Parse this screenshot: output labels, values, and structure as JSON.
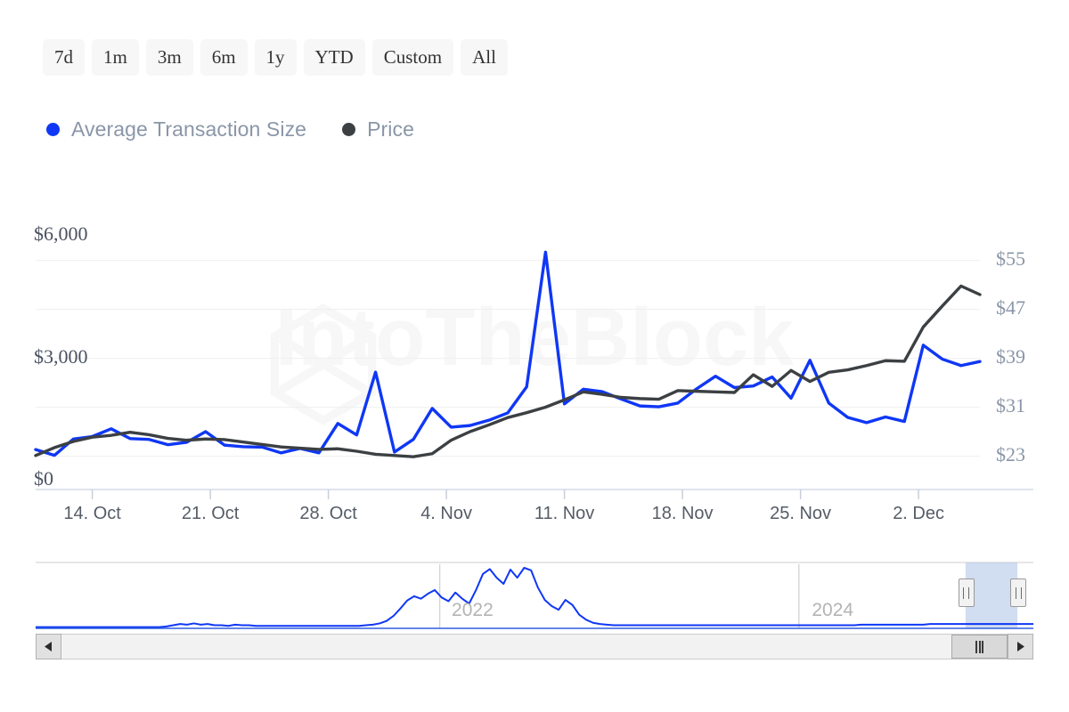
{
  "range_selector": {
    "buttons": [
      {
        "label": "7d",
        "selected": false
      },
      {
        "label": "1m",
        "selected": false
      },
      {
        "label": "3m",
        "selected": false
      },
      {
        "label": "6m",
        "selected": false
      },
      {
        "label": "1y",
        "selected": false
      },
      {
        "label": "YTD",
        "selected": false
      },
      {
        "label": "Custom",
        "selected": false
      },
      {
        "label": "All",
        "selected": false
      }
    ]
  },
  "legend": {
    "items": [
      {
        "label": "Average Transaction Size",
        "color": "#0f37f5",
        "icon": "circle-marker-icon"
      },
      {
        "label": "Price",
        "color": "#3c4043",
        "icon": "circle-marker-icon"
      }
    ]
  },
  "watermark": {
    "text": "IntoTheBlock",
    "logo": "hexagon-logo-icon"
  },
  "navigator": {
    "year_labels": [
      "2022",
      "2024"
    ],
    "left_handle": "navigator-left-handle",
    "right_handle": "navigator-right-handle"
  },
  "scrollbar": {
    "left_arrow": "scroll-left-arrow-icon",
    "right_arrow": "scroll-right-arrow-icon",
    "thumb": "scrollbar-thumb-grip-icon"
  },
  "chart_data": {
    "type": "line",
    "title": "",
    "xlabel": "",
    "ylabel": "Average Transaction Size",
    "y2label": "Price",
    "grid": true,
    "legend_position": "top-left",
    "x_tick_labels": [
      "14. Oct",
      "21. Oct",
      "28. Oct",
      "4. Nov",
      "11. Nov",
      "18. Nov",
      "25. Nov",
      "2. Dec"
    ],
    "x_tick_positions": [
      0.06,
      0.185,
      0.31,
      0.435,
      0.56,
      0.685,
      0.81,
      0.935
    ],
    "y_left_ticks": [
      "$0",
      "$3,000",
      "$6,000"
    ],
    "y_left_tick_values": [
      0,
      3000,
      6000
    ],
    "ylim": [
      0,
      6000
    ],
    "y_right_ticks": [
      "$23",
      "$31",
      "$39",
      "$47",
      "$55"
    ],
    "y_right_tick_values": [
      23,
      31,
      39,
      47,
      55
    ],
    "y2lim": [
      19,
      59
    ],
    "series": [
      {
        "name": "Average Transaction Size",
        "color": "#0f37f5",
        "axis": "left",
        "values": [
          760,
          620,
          1020,
          1080,
          1270,
          1030,
          1010,
          880,
          940,
          1200,
          870,
          830,
          820,
          680,
          790,
          680,
          1400,
          1120,
          2660,
          700,
          1010,
          1770,
          1310,
          1350,
          1480,
          1660,
          2300,
          5600,
          1880,
          2240,
          2180,
          2000,
          1830,
          1810,
          1900,
          2250,
          2560,
          2280,
          2320,
          2540,
          2020,
          2950,
          1900,
          1550,
          1420,
          1560,
          1450,
          3320,
          2980,
          2820,
          2920
        ]
      },
      {
        "name": "Price",
        "color": "#3c4043",
        "axis": "right",
        "values": [
          23.1,
          24.4,
          25.4,
          26.1,
          26.4,
          26.9,
          26.5,
          25.9,
          25.6,
          25.8,
          25.7,
          25.3,
          24.9,
          24.5,
          24.3,
          24.1,
          24.2,
          23.8,
          23.3,
          23.1,
          22.9,
          23.4,
          25.6,
          27.0,
          28.1,
          29.3,
          30.1,
          31.0,
          32.2,
          33.5,
          33.1,
          32.6,
          32.4,
          32.3,
          33.7,
          33.6,
          33.5,
          33.4,
          36.3,
          34.4,
          37.0,
          35.2,
          36.7,
          37.1,
          37.8,
          38.6,
          38.5,
          44.1,
          47.5,
          50.8,
          49.4
        ]
      }
    ],
    "navigator_series": {
      "name": "Average Transaction Size",
      "color": "#0f37f5",
      "values": [
        2,
        2,
        2,
        2,
        2,
        2,
        2,
        2,
        2,
        2,
        2,
        2,
        2,
        2,
        2,
        2,
        2,
        2,
        2,
        3,
        5,
        7,
        6,
        8,
        6,
        7,
        5,
        5,
        4,
        6,
        5,
        5,
        4,
        4,
        4,
        4,
        4,
        4,
        4,
        4,
        4,
        4,
        4,
        4,
        4,
        4,
        4,
        4,
        5,
        6,
        8,
        12,
        20,
        32,
        45,
        52,
        48,
        56,
        62,
        50,
        44,
        58,
        48,
        40,
        62,
        88,
        96,
        82,
        72,
        95,
        82,
        98,
        94,
        66,
        46,
        36,
        30,
        46,
        38,
        22,
        14,
        9,
        7,
        6,
        5,
        5,
        5,
        5,
        5,
        5,
        5,
        5,
        5,
        5,
        5,
        5,
        5,
        5,
        5,
        5,
        5,
        5,
        5,
        5,
        5,
        5,
        5,
        5,
        5,
        5,
        5,
        5,
        5,
        5,
        5,
        5,
        5,
        5,
        5,
        5,
        6,
        6,
        6,
        6,
        6,
        6,
        6,
        6,
        6,
        6,
        7,
        7,
        7,
        7,
        7,
        7,
        7,
        7,
        7,
        7,
        7,
        7,
        7,
        7,
        7,
        7
      ]
    }
  }
}
